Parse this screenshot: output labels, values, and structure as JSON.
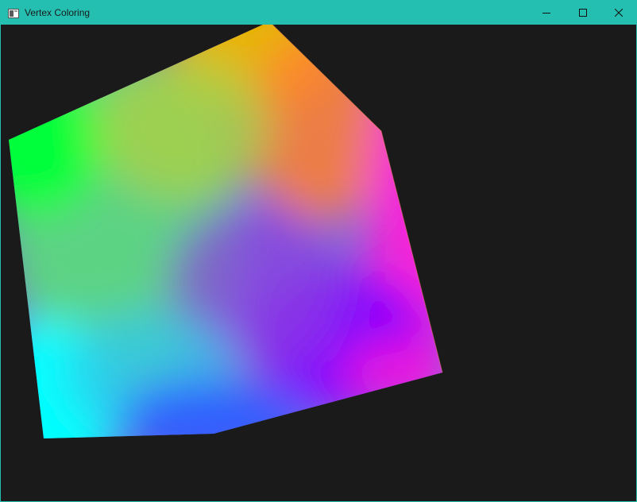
{
  "window": {
    "title": "Vertex Coloring",
    "app_icon": "app-window-icon",
    "controls": [
      "minimize-icon",
      "maximize-icon",
      "close-icon"
    ]
  },
  "colors": {
    "titlebar": "#24bfb0",
    "title_text": "#1b1b1b",
    "background": "#1a1a1a",
    "vertex_top": "#f4a000",
    "vertex_green": "#00ff3a",
    "vertex_cyan": "#00ffff",
    "vertex_blue": "#0050ff",
    "vertex_magenta": "#ff00e6",
    "vertex_violet": "#8a00ff"
  }
}
